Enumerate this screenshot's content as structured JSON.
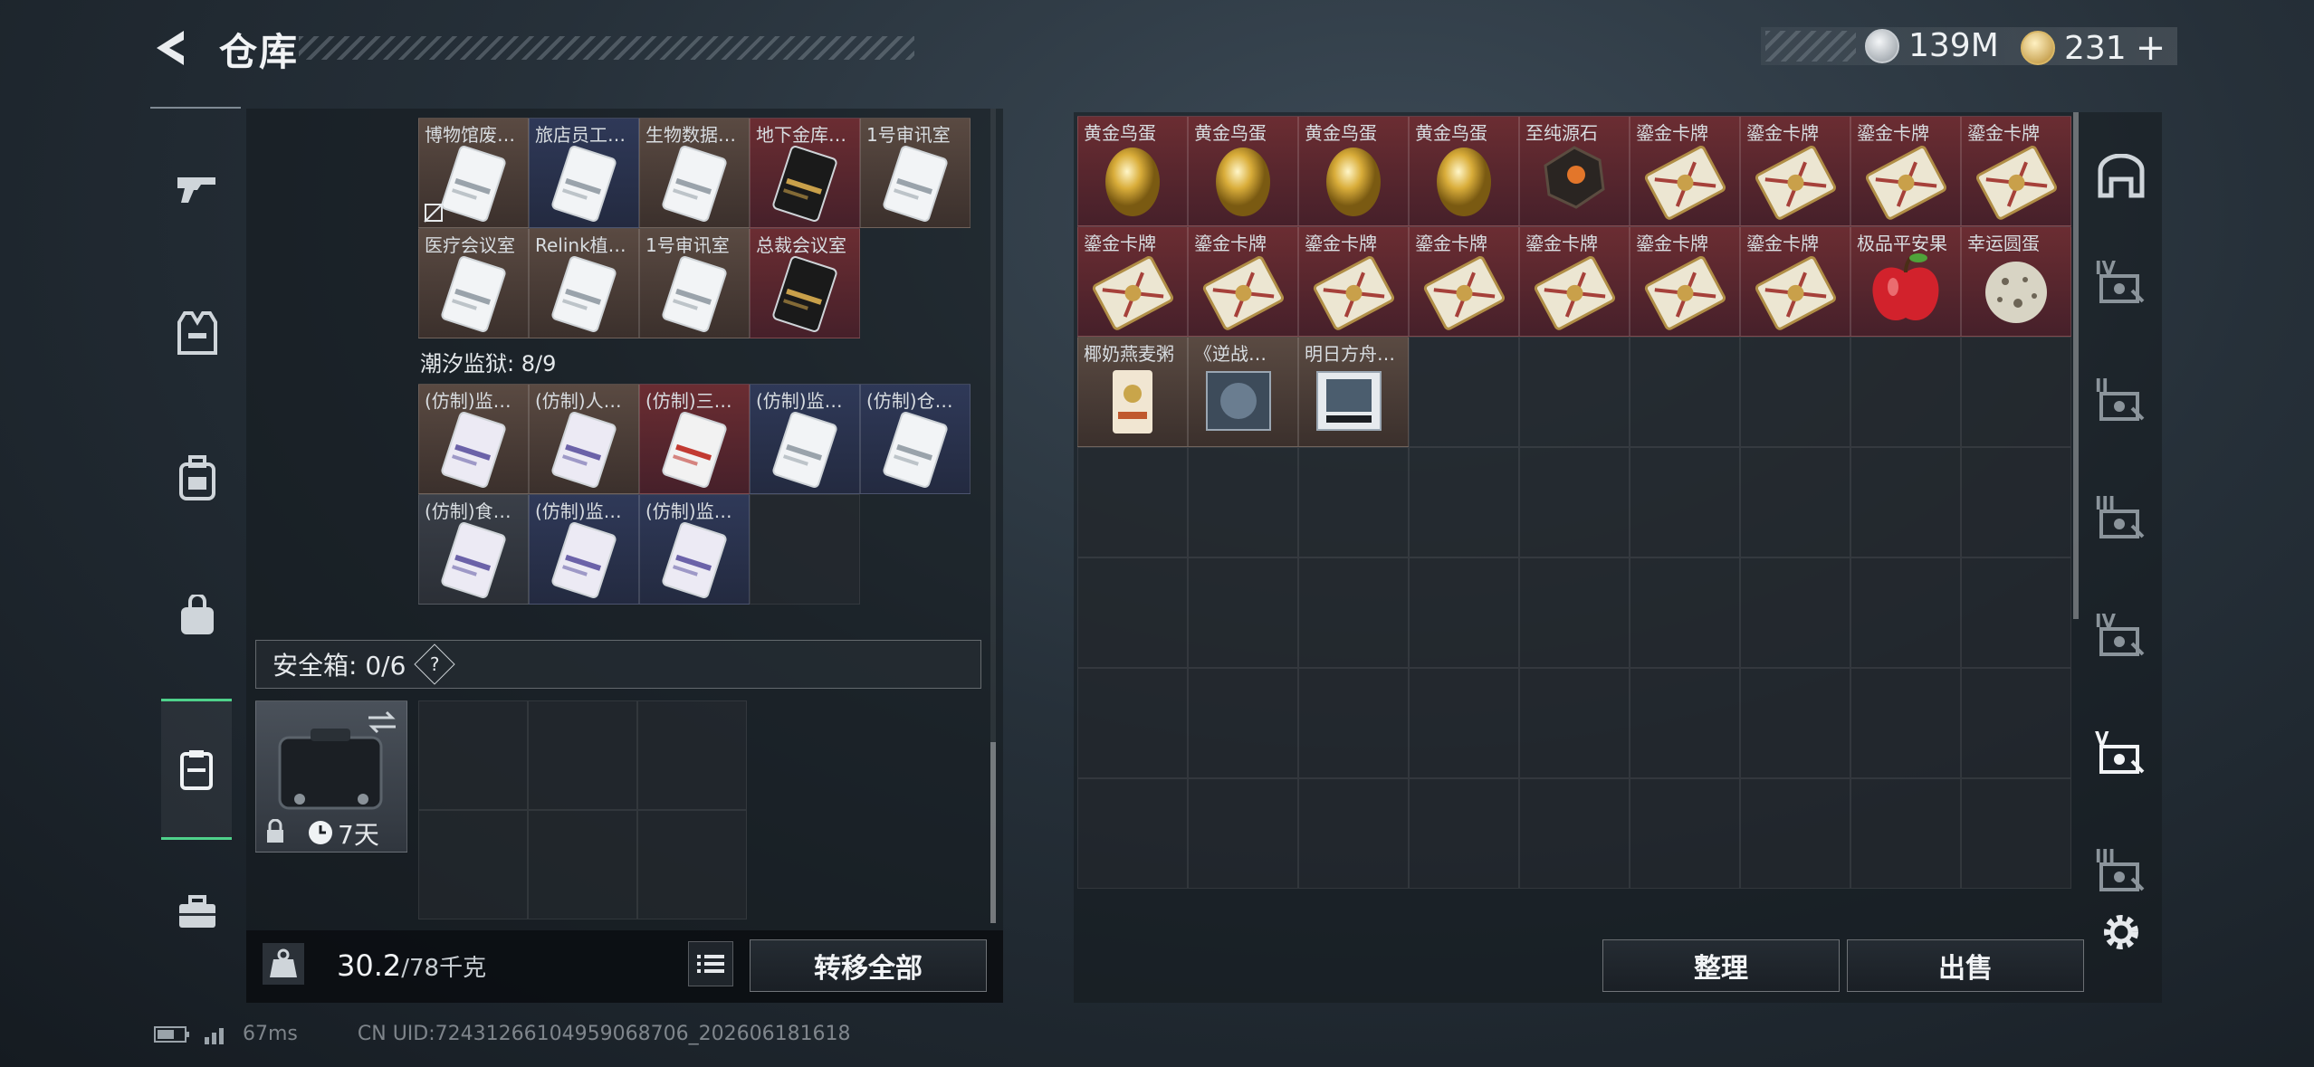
{
  "header": {
    "title": "仓库"
  },
  "currency": {
    "silver": "139M",
    "gold": "231",
    "plus": "+"
  },
  "left": {
    "row1": [
      {
        "label": "博物馆废…",
        "color": "brown",
        "card": "silver",
        "lock": true
      },
      {
        "label": "旅店员工…",
        "color": "blue",
        "card": "silver"
      },
      {
        "label": "生物数据…",
        "color": "brown",
        "card": "silver"
      },
      {
        "label": "地下金库…",
        "color": "red",
        "card": "gold"
      },
      {
        "label": "1号审讯室",
        "color": "brown",
        "card": "silver"
      }
    ],
    "row2": [
      {
        "label": "医疗会议室",
        "color": "brown",
        "card": "silver"
      },
      {
        "label": "Relink植…",
        "color": "brown",
        "card": "silver"
      },
      {
        "label": "1号审讯室",
        "color": "brown",
        "card": "silver"
      },
      {
        "label": "总裁会议室",
        "color": "red",
        "card": "gold"
      }
    ],
    "prison_label": "潮汐监狱: 8/9",
    "row3": [
      {
        "label": "(仿制)监…",
        "color": "brown",
        "card": "purple"
      },
      {
        "label": "(仿制)人…",
        "color": "brown",
        "card": "purple"
      },
      {
        "label": "(仿制)三…",
        "color": "red",
        "card": "red"
      },
      {
        "label": "(仿制)监…",
        "color": "blue",
        "card": "silver"
      },
      {
        "label": "(仿制)仓…",
        "color": "blue",
        "card": "silver"
      }
    ],
    "row4": [
      {
        "label": "(仿制)食…",
        "color": "gray",
        "card": "purple"
      },
      {
        "label": "(仿制)监…",
        "color": "blue",
        "card": "purple"
      },
      {
        "label": "(仿制)监…",
        "color": "blue",
        "card": "purple"
      }
    ],
    "safebox_label": "安全箱: 0/6",
    "safebox_help": "?",
    "case_time": "7天",
    "weight_value": "30.2",
    "weight_max": "/78千克",
    "transfer_all": "转移全部"
  },
  "right": {
    "items": [
      {
        "label": "黄金鸟蛋",
        "kind": "egg"
      },
      {
        "label": "黄金鸟蛋",
        "kind": "egg"
      },
      {
        "label": "黄金鸟蛋",
        "kind": "egg"
      },
      {
        "label": "黄金鸟蛋",
        "kind": "egg"
      },
      {
        "label": "至纯源石",
        "kind": "stone"
      },
      {
        "label": "鎏金卡牌",
        "kind": "card"
      },
      {
        "label": "鎏金卡牌",
        "kind": "card"
      },
      {
        "label": "鎏金卡牌",
        "kind": "card"
      },
      {
        "label": "鎏金卡牌",
        "kind": "card"
      },
      {
        "label": "鎏金卡牌",
        "kind": "card"
      },
      {
        "label": "鎏金卡牌",
        "kind": "card"
      },
      {
        "label": "鎏金卡牌",
        "kind": "card"
      },
      {
        "label": "鎏金卡牌",
        "kind": "card"
      },
      {
        "label": "鎏金卡牌",
        "kind": "card"
      },
      {
        "label": "鎏金卡牌",
        "kind": "card"
      },
      {
        "label": "鎏金卡牌",
        "kind": "card"
      },
      {
        "label": "极品平安果",
        "kind": "apple"
      },
      {
        "label": "幸运圆蛋",
        "kind": "speckled"
      },
      {
        "label": "椰奶燕麦粥",
        "kind": "porridge"
      },
      {
        "label": "《逆战…",
        "kind": "disc"
      },
      {
        "label": "明日方舟…",
        "kind": "disc2"
      }
    ],
    "tidy": "整理",
    "sell": "出售",
    "side_tabs": [
      "IV",
      "II",
      "III",
      "IV",
      "V",
      "III"
    ]
  },
  "footer": {
    "ping": "67ms",
    "uid": "CN UID:72431266104959068706_202606181618"
  }
}
